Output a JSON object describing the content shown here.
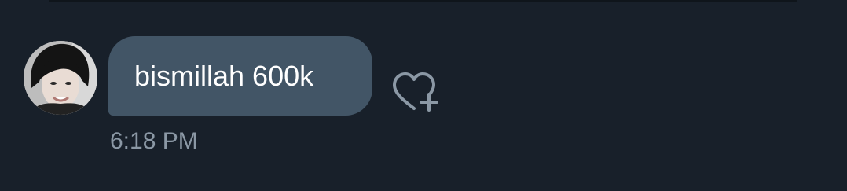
{
  "conversation": {
    "message": {
      "text": "bismillah 600k",
      "timestamp": "6:18 PM",
      "avatar_icon": "user-avatar-photo",
      "react_icon": "heart-plus-icon"
    }
  },
  "colors": {
    "background": "#18202a",
    "bubble": "#425566",
    "bubble_text": "#ffffff",
    "timestamp": "#8b98a5",
    "icon": "#8b98a5"
  }
}
